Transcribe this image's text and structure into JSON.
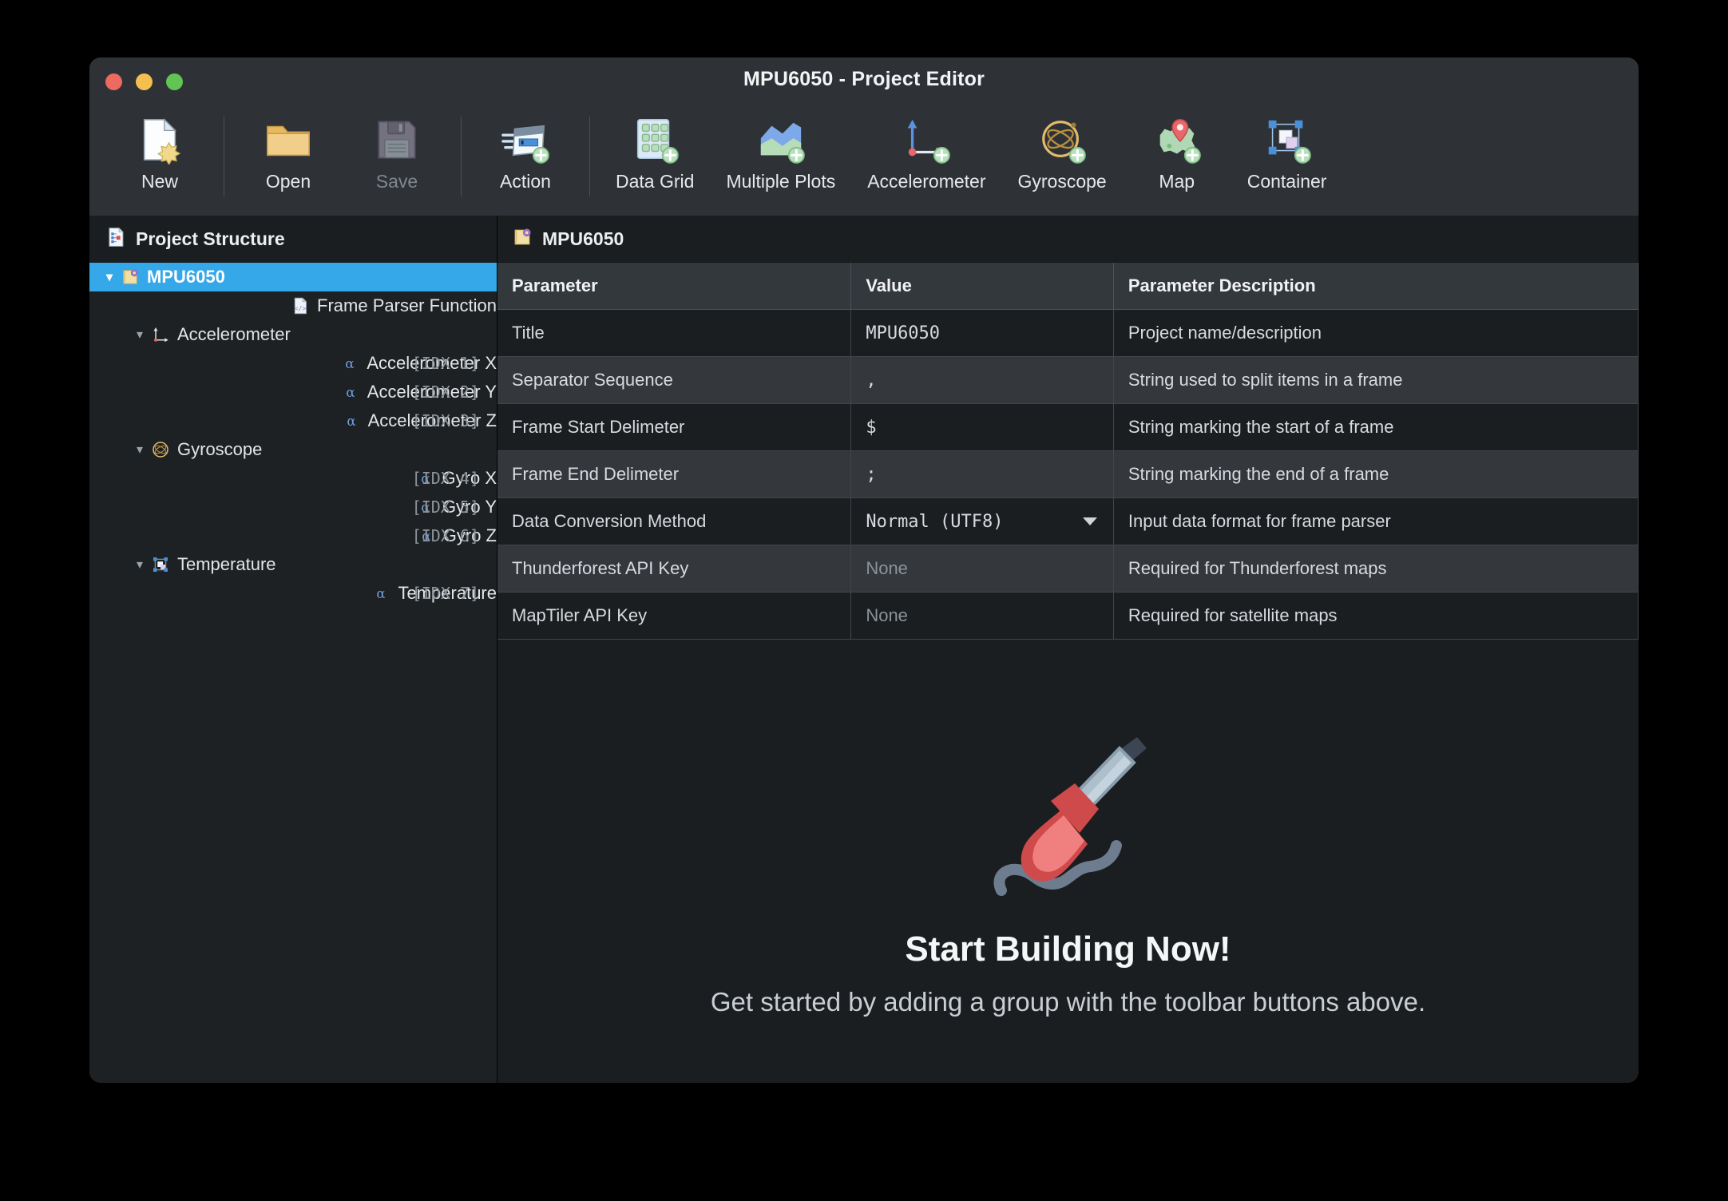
{
  "window": {
    "title": "MPU6050 - Project Editor",
    "traffic_lights": [
      "close-button",
      "minimize-button",
      "zoom-button"
    ],
    "accent_color": "#34a8e8",
    "background_color": "#1e2124"
  },
  "toolbar": {
    "items": [
      {
        "label": "New",
        "icon": "new-file-icon",
        "enabled": true
      },
      {
        "label": "Open",
        "icon": "open-folder-icon",
        "enabled": true
      },
      {
        "label": "Save",
        "icon": "save-floppy-icon",
        "enabled": false
      },
      {
        "label": "Action",
        "icon": "action-icon",
        "enabled": true
      },
      {
        "label": "Data Grid",
        "icon": "data-grid-icon",
        "enabled": true
      },
      {
        "label": "Multiple Plots",
        "icon": "multiple-plots-icon",
        "enabled": true
      },
      {
        "label": "Accelerometer",
        "icon": "accelerometer-icon",
        "enabled": true
      },
      {
        "label": "Gyroscope",
        "icon": "gyroscope-icon",
        "enabled": true
      },
      {
        "label": "Map",
        "icon": "map-icon",
        "enabled": true
      },
      {
        "label": "Container",
        "icon": "container-icon",
        "enabled": true
      }
    ]
  },
  "sidebar": {
    "header": {
      "title": "Project Structure",
      "icon": "project-structure-icon"
    },
    "tree": [
      {
        "label": "MPU6050",
        "icon": "project-folder-icon",
        "depth": 0,
        "twisty": "expanded",
        "selected": true,
        "index": ""
      },
      {
        "label": "Frame Parser Function",
        "icon": "code-file-icon",
        "depth": 1,
        "twisty": "none",
        "selected": false,
        "index": ""
      },
      {
        "label": "Accelerometer",
        "icon": "accelerometer-icon",
        "depth": 1,
        "twisty": "expanded",
        "selected": false,
        "index": ""
      },
      {
        "label": "Accelerometer X",
        "icon": "dataset-alpha-icon",
        "depth": 2,
        "twisty": "none",
        "selected": false,
        "index": "[IDX 1]"
      },
      {
        "label": "Accelerometer Y",
        "icon": "dataset-alpha-icon",
        "depth": 2,
        "twisty": "none",
        "selected": false,
        "index": "[IDX 2]"
      },
      {
        "label": "Accelerometer Z",
        "icon": "dataset-alpha-icon",
        "depth": 2,
        "twisty": "none",
        "selected": false,
        "index": "[IDX 3]"
      },
      {
        "label": "Gyroscope",
        "icon": "gyroscope-icon",
        "depth": 1,
        "twisty": "expanded",
        "selected": false,
        "index": ""
      },
      {
        "label": "Gyro X",
        "icon": "dataset-alpha-icon",
        "depth": 2,
        "twisty": "none",
        "selected": false,
        "index": "[IDX 4]"
      },
      {
        "label": "Gyro Y",
        "icon": "dataset-alpha-icon",
        "depth": 2,
        "twisty": "none",
        "selected": false,
        "index": "[IDX 5]"
      },
      {
        "label": "Gyro Z",
        "icon": "dataset-alpha-icon",
        "depth": 2,
        "twisty": "none",
        "selected": false,
        "index": "[IDX 6]"
      },
      {
        "label": "Temperature",
        "icon": "container-icon",
        "depth": 1,
        "twisty": "expanded",
        "selected": false,
        "index": ""
      },
      {
        "label": "Temperature",
        "icon": "dataset-alpha-icon",
        "depth": 2,
        "twisty": "none",
        "selected": false,
        "index": "[IDX 7]"
      }
    ]
  },
  "main": {
    "header": {
      "title": "MPU6050",
      "icon": "project-folder-icon"
    },
    "table": {
      "columns": [
        "Parameter",
        "Value",
        "Parameter Description"
      ],
      "rows": [
        {
          "parameter": "Title",
          "value": "MPU6050",
          "placeholder": false,
          "dropdown": false,
          "description": "Project name/description"
        },
        {
          "parameter": "Separator Sequence",
          "value": ",",
          "placeholder": false,
          "dropdown": false,
          "description": "String used to split items in a frame"
        },
        {
          "parameter": "Frame Start Delimeter",
          "value": "$",
          "placeholder": false,
          "dropdown": false,
          "description": "String marking the start of a frame"
        },
        {
          "parameter": "Frame End Delimeter",
          "value": ";",
          "placeholder": false,
          "dropdown": false,
          "description": "String marking the end of a frame"
        },
        {
          "parameter": "Data Conversion Method",
          "value": "Normal (UTF8)",
          "placeholder": false,
          "dropdown": true,
          "description": "Input data format for frame parser"
        },
        {
          "parameter": "Thunderforest API Key",
          "value": "None",
          "placeholder": true,
          "dropdown": false,
          "description": "Required for Thunderforest maps"
        },
        {
          "parameter": "MapTiler API Key",
          "value": "None",
          "placeholder": true,
          "dropdown": false,
          "description": "Required for satellite maps"
        }
      ]
    },
    "empty_state": {
      "illustration": "soldering-iron-icon",
      "title": "Start Building Now!",
      "subtitle": "Get started by adding a group with the toolbar buttons above."
    }
  }
}
